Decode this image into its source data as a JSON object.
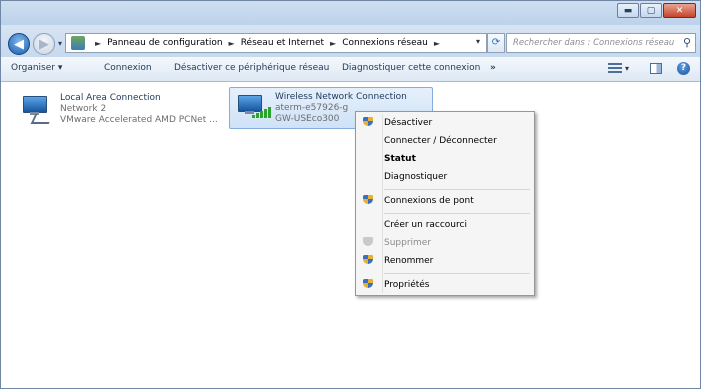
{
  "window": {
    "controls": {
      "minimize": "▬",
      "maximize": "▢",
      "close": "✕"
    }
  },
  "address": {
    "crumbs": [
      "Panneau de configuration",
      "Réseau et Internet",
      "Connexions réseau"
    ],
    "separator": "►",
    "dropdown": "▾",
    "search_placeholder": "Rechercher dans : Connexions réseau"
  },
  "toolbar": {
    "items": [
      "Organiser ▾",
      "Connexion",
      "Désactiver ce périphérique réseau",
      "Diagnostiquer cette connexion",
      "»"
    ]
  },
  "connections": [
    {
      "title": "Local Area Connection",
      "line1": "Network  2",
      "line2": "VMware Accelerated AMD PCNet ..."
    },
    {
      "title": "Wireless Network Connection",
      "line1": "aterm-e57926-g",
      "line2": "GW-USEco300"
    }
  ],
  "context_menu": {
    "items": [
      {
        "label": "Désactiver",
        "shield": true,
        "bold": false,
        "disabled": false
      },
      {
        "label": "Connecter / Déconnecter",
        "shield": false,
        "bold": false,
        "disabled": false
      },
      {
        "label": "Statut",
        "shield": false,
        "bold": true,
        "disabled": false
      },
      {
        "label": "Diagnostiquer",
        "shield": false,
        "bold": false,
        "disabled": false
      },
      {
        "label": "Connexions de pont",
        "shield": true,
        "bold": false,
        "disabled": false
      },
      {
        "label": "Créer un raccourci",
        "shield": false,
        "bold": false,
        "disabled": false
      },
      {
        "label": "Supprimer",
        "shield": true,
        "bold": false,
        "disabled": true
      },
      {
        "label": "Renommer",
        "shield": true,
        "bold": false,
        "disabled": false
      },
      {
        "label": "Propriétés",
        "shield": true,
        "bold": false,
        "disabled": false
      }
    ]
  },
  "icons": {
    "back": "◀",
    "forward": "▶",
    "refresh": "⟳",
    "search": "⚲",
    "help": "?"
  }
}
